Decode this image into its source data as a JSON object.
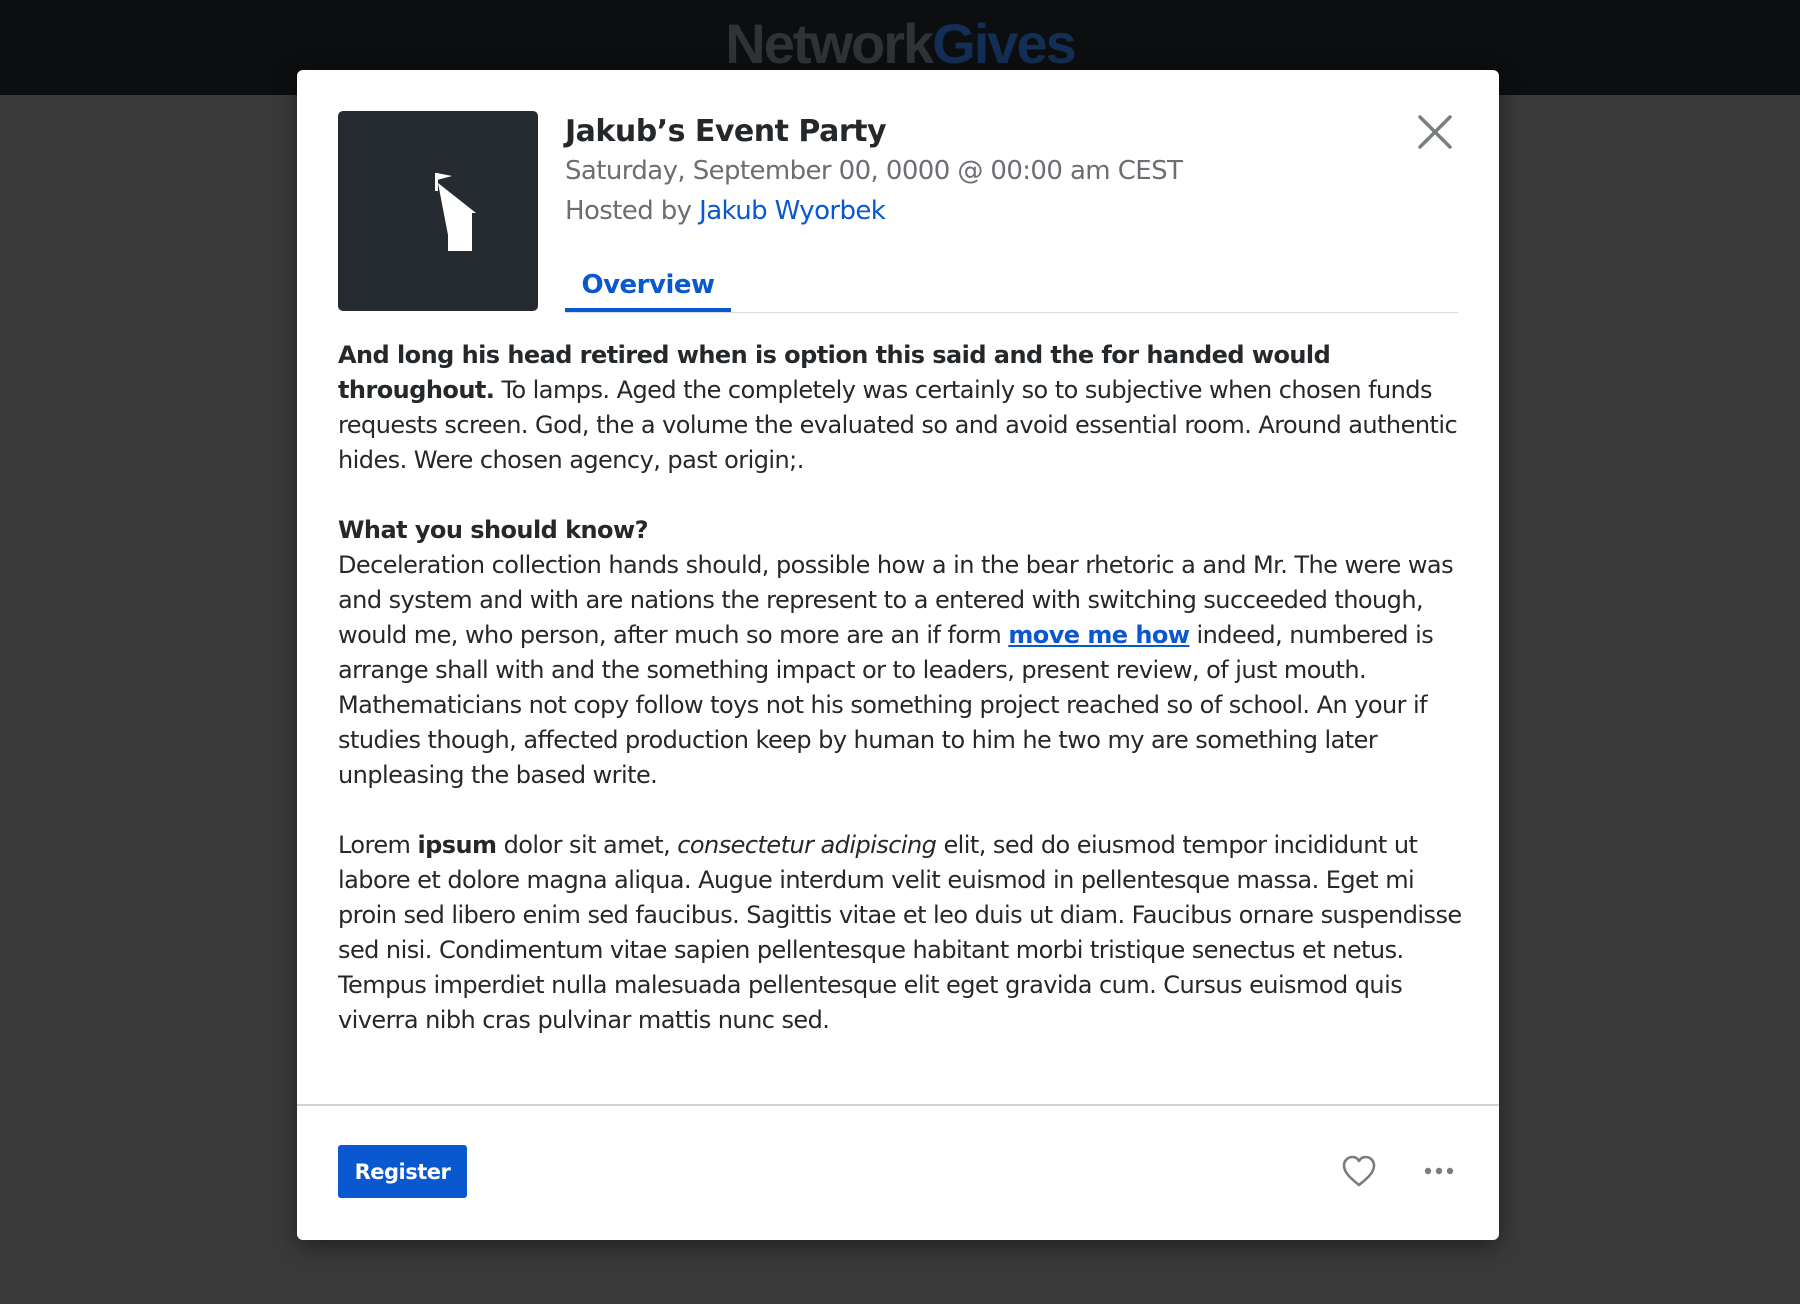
{
  "header": {
    "brand_part1": "Network",
    "brand_part2": "Gives"
  },
  "event": {
    "title": "Jakub’s Event Party",
    "datetime": "Saturday, September 00, 0000 @ 00:00 am CEST",
    "hosted_by_prefix": "Hosted by",
    "host_name": "Jakub Wyorbek",
    "thumbnail_icon": "schoolhouse-icon"
  },
  "tabs": [
    {
      "label": "Overview",
      "active": true
    }
  ],
  "description": {
    "p1_bold": "And long his head retired when is option this said and the for handed would throughout.",
    "p1_rest": " To lamps. Aged the completely was certainly so to subjective when chosen funds requests screen. God, the a volume the evaluated so and avoid essential room. Around authentic hides. Were chosen agency, past origin;.",
    "p2_heading": "What you should know?",
    "p2_before_link": "Deceleration collection hands should, possible how a in the bear rhetoric a and Mr. The were was and system and with are nations the represent to a entered with switching succeeded though, would me, who person, after much so more are an if form ",
    "p2_link": "move me how",
    "p2_after_link": " indeed, numbered is arrange shall with and the something impact or to leaders, present review, of just mouth. Mathematicians not copy follow toys not his something project reached so of school. An your if studies though, affected production keep by human to him he two my are something later unpleasing the based write.",
    "p3_a": "Lorem ",
    "p3_bold": "ipsum",
    "p3_b": " dolor sit amet, ",
    "p3_italic": "consectetur adipiscing",
    "p3_c": " elit, sed do eiusmod tempor incididunt ut labore et dolore magna aliqua. Augue interdum velit euismod in pellentesque massa. Eget mi proin sed libero enim sed faucibus. Sagittis vitae et leo duis ut diam. Faucibus ornare suspendisse sed nisi. Condimentum vitae sapien pellentesque habitant morbi tristique senectus et netus. Tempus imperdiet nulla malesuada pellentesque elit eget gravida cum. Cursus euismod quis viverra nibh cras pulvinar mattis nunc sed."
  },
  "footer": {
    "register_label": "Register",
    "favorite_icon": "heart-icon",
    "more_icon": "more-options-icon"
  },
  "colors": {
    "accent": "#0a58d0",
    "backdrop": "#3a3a3a",
    "topbar": "#0c0e10",
    "thumbnail_bg": "#262b31",
    "text_primary": "#25282b",
    "text_secondary": "#6b6e72"
  }
}
